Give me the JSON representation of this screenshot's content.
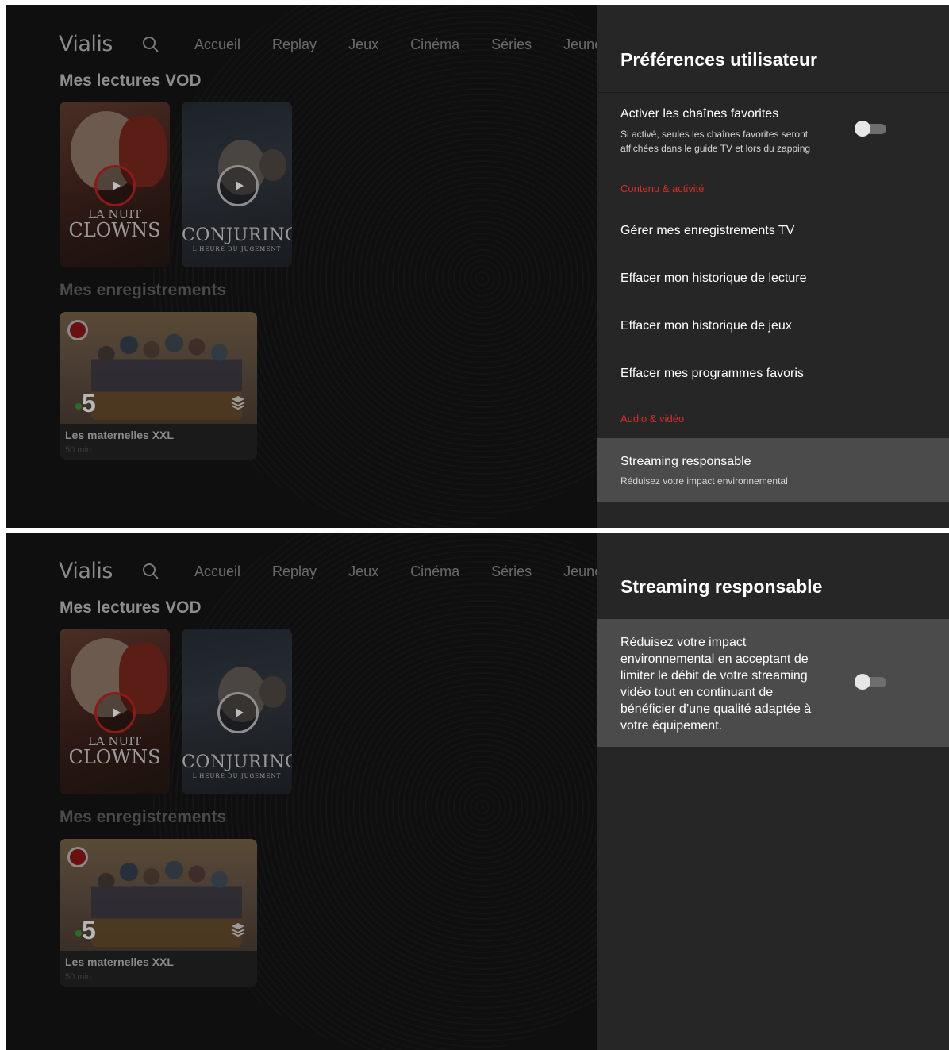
{
  "app": {
    "logo": "Vialis",
    "nav": [
      "Accueil",
      "Replay",
      "Jeux",
      "Cinéma",
      "Séries",
      "Jeune"
    ],
    "vod_row_title": "Mes lectures VOD",
    "recordings_row_title": "Mes enregistrements",
    "posters": [
      {
        "title_line1": "LA NUIT",
        "title_line2": "CLOWNS"
      },
      {
        "title_line1": "CONJURING",
        "title_line2": "L'HEURE DU JUGEMENT"
      }
    ],
    "recording": {
      "channel": "5",
      "title": "Les maternelles XXL",
      "duration": "50 min"
    }
  },
  "screen1": {
    "panel_title": "Préférences utilisateur",
    "favorites": {
      "label": "Activer les chaînes favorites",
      "sub_line1": "Si activé, seules les chaînes favorites seront",
      "sub_line2": "affichées dans le guide TV et lors du zapping",
      "enabled": false
    },
    "section_content": "Contenu & activité",
    "items": [
      "Gérer mes enregistrements TV",
      "Effacer mon historique de lecture",
      "Effacer mon historique de jeux",
      "Effacer mes programmes favoris"
    ],
    "section_audio": "Audio & vidéo",
    "streaming": {
      "label": "Streaming responsable",
      "sub": "Réduisez votre impact environnemental"
    }
  },
  "screen2": {
    "panel_title": "Streaming responsable",
    "description_lines": [
      "Réduisez votre impact",
      "environnemental en acceptant de",
      "limiter le débit de votre streaming",
      "vidéo tout en continuant de",
      "bénéficier d’une qualité adaptée à",
      "votre équipement."
    ],
    "enabled": false
  },
  "colors": {
    "accent_red": "#d12f2a",
    "panel_bg": "#262626",
    "highlight_bg": "#4b4b4b",
    "screen_bg": "#0f0f0f"
  }
}
